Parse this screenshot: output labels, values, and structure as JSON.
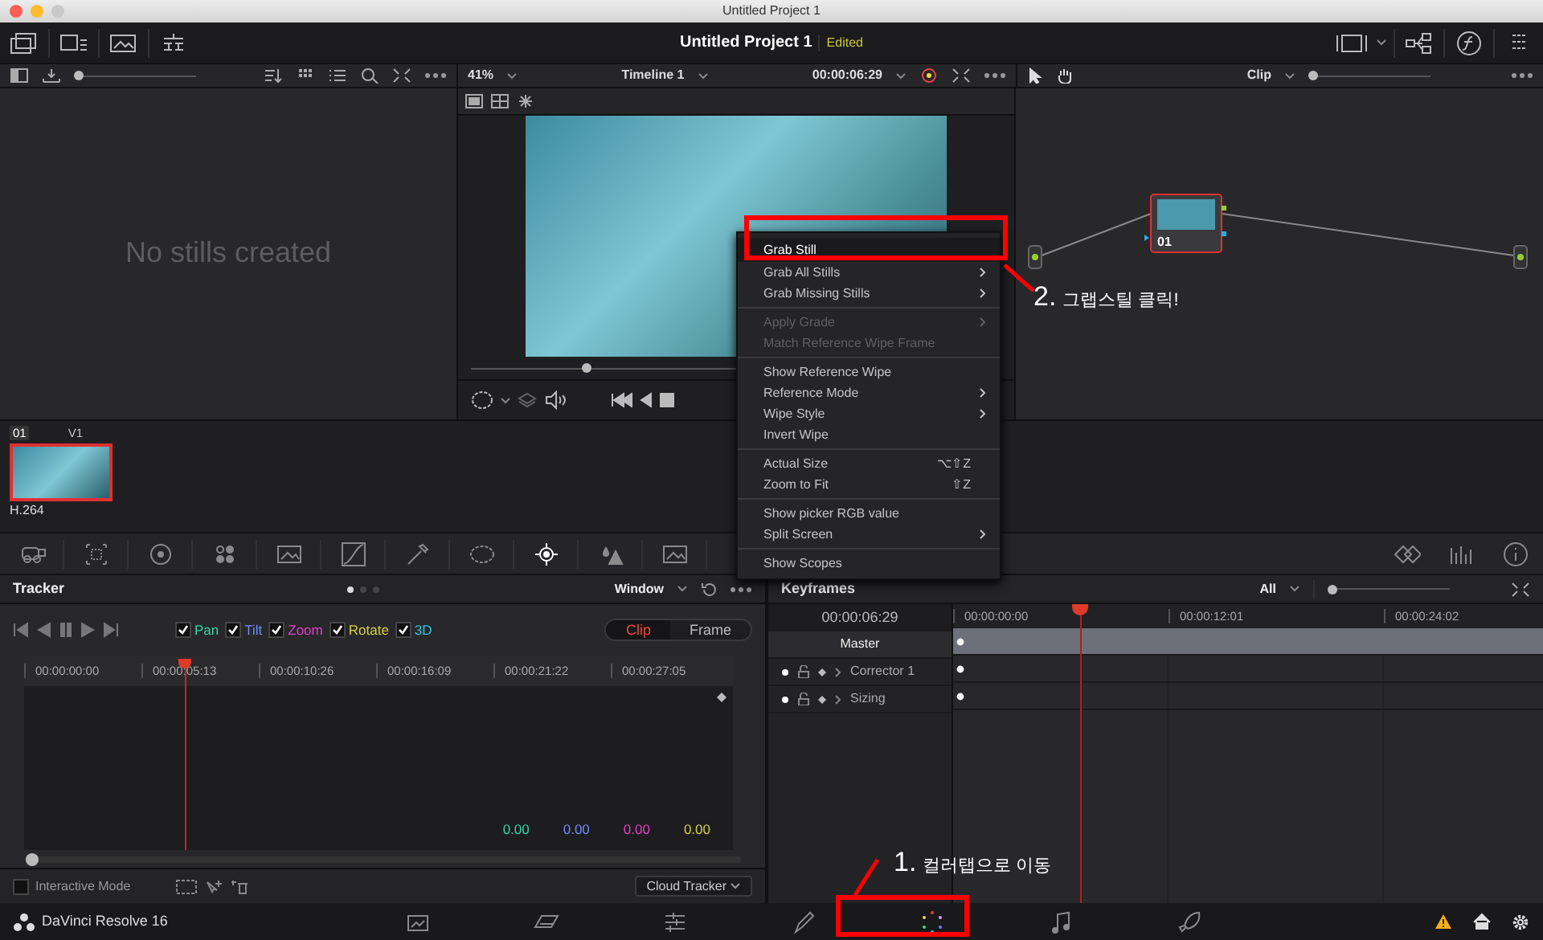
{
  "window": {
    "title": "Untitled Project 1"
  },
  "header": {
    "project": "Untitled Project 1",
    "status": "Edited"
  },
  "gallery": {
    "message": "No stills created",
    "size_slider": {
      "level": 0
    }
  },
  "viewer": {
    "zoom": "41%",
    "timeline": "Timeline 1",
    "timecode": "00:00:06:29",
    "scrubber": {
      "level": 0.22
    }
  },
  "node_editor": {
    "mode": "Clip",
    "node_label": "01",
    "zoom_slider": {
      "level": 0
    }
  },
  "clip": {
    "number": "01",
    "track": "V1",
    "codec": "H.264",
    "selected": true
  },
  "tools": [
    {
      "kind": "camera",
      "selected": false
    },
    {
      "kind": "grid",
      "selected": false
    },
    {
      "kind": "ring",
      "selected": false
    },
    {
      "kind": "dots",
      "selected": false
    },
    {
      "kind": "picture",
      "selected": false
    },
    {
      "kind": "curve",
      "selected": false
    },
    {
      "kind": "dropper",
      "selected": false
    },
    {
      "kind": "window",
      "selected": false
    },
    {
      "kind": "target",
      "selected": true
    },
    {
      "kind": "drops",
      "selected": false
    },
    {
      "kind": "picture",
      "selected": false
    }
  ],
  "side_tools": [
    {
      "kind": "diamond",
      "selected": false
    },
    {
      "kind": "bars",
      "selected": false
    },
    {
      "kind": "info",
      "selected": false
    }
  ],
  "context_menu": {
    "groups": [
      [
        {
          "label": "Grab Still",
          "selected": true,
          "disabled": false,
          "submenu": false
        },
        {
          "label": "Grab All Stills",
          "selected": false,
          "disabled": false,
          "submenu": true
        },
        {
          "label": "Grab Missing Stills",
          "selected": false,
          "disabled": false,
          "submenu": true
        }
      ],
      [
        {
          "label": "Apply Grade",
          "selected": false,
          "disabled": true,
          "submenu": true
        },
        {
          "label": "Match Reference Wipe Frame",
          "selected": false,
          "disabled": true,
          "submenu": false
        }
      ],
      [
        {
          "label": "Show Reference Wipe",
          "selected": false,
          "disabled": false,
          "submenu": false
        },
        {
          "label": "Reference Mode",
          "selected": false,
          "disabled": false,
          "submenu": true
        },
        {
          "label": "Wipe Style",
          "selected": false,
          "disabled": false,
          "submenu": true
        },
        {
          "label": "Invert Wipe",
          "selected": false,
          "disabled": false,
          "submenu": false
        }
      ],
      [
        {
          "label": "Actual Size",
          "shortcut": "⌥⇧Z",
          "selected": false,
          "disabled": false,
          "submenu": false
        },
        {
          "label": "Zoom to Fit",
          "shortcut": "⇧Z",
          "selected": false,
          "disabled": false,
          "submenu": false
        }
      ],
      [
        {
          "label": "Show picker RGB value",
          "selected": false,
          "disabled": false,
          "submenu": false
        },
        {
          "label": "Split Screen",
          "selected": false,
          "disabled": false,
          "submenu": true
        }
      ],
      [
        {
          "label": "Show Scopes",
          "selected": false,
          "disabled": false,
          "submenu": false
        }
      ]
    ]
  },
  "tracker": {
    "title": "Tracker",
    "pages": [
      {
        "selected": true
      },
      {
        "selected": false
      },
      {
        "selected": false
      }
    ],
    "window_mode": "Window",
    "channels": [
      {
        "label": "Pan",
        "checked": true,
        "color": "#33d6a4"
      },
      {
        "label": "Tilt",
        "checked": true,
        "color": "#6f8cff"
      },
      {
        "label": "Zoom",
        "checked": true,
        "color": "#e040c8"
      },
      {
        "label": "Rotate",
        "checked": true,
        "color": "#d6d042"
      },
      {
        "label": "3D",
        "checked": true,
        "color": "#2ec6e0"
      }
    ],
    "modes": [
      {
        "label": "Clip",
        "selected": true
      },
      {
        "label": "Frame",
        "selected": false
      }
    ],
    "ruler": [
      "00:00:00:00",
      "00:00:05:13",
      "00:00:10:26",
      "00:00:16:09",
      "00:00:21:22",
      "00:00:27:05"
    ],
    "values": [
      {
        "text": "0.00",
        "color": "#33d6a4"
      },
      {
        "text": "0.00",
        "color": "#6f8cff"
      },
      {
        "text": "0.00",
        "color": "#e040c8"
      },
      {
        "text": "0.00",
        "color": "#d6d042"
      }
    ],
    "interactive_mode": {
      "label": "Interactive Mode",
      "checked": false
    },
    "tracker_type": "Cloud Tracker"
  },
  "keyframes": {
    "title": "Keyframes",
    "filter": "All",
    "zoom_slider": {
      "level": 0
    },
    "timecode": "00:00:06:29",
    "ruler": [
      "00:00:00:00",
      "00:00:12:01",
      "00:00:24:02"
    ],
    "tracks": [
      {
        "label": "Master",
        "selected": true,
        "expandable": false
      },
      {
        "label": "Corrector 1",
        "selected": false,
        "expandable": true
      },
      {
        "label": "Sizing",
        "selected": false,
        "expandable": true
      }
    ]
  },
  "footer": {
    "app": "DaVinci Resolve 16",
    "pages": [
      {
        "kind": "media",
        "selected": false
      },
      {
        "kind": "cut",
        "selected": false
      },
      {
        "kind": "edit",
        "selected": false
      },
      {
        "kind": "fusion",
        "selected": false
      },
      {
        "kind": "color",
        "selected": true
      },
      {
        "kind": "fairlight",
        "selected": false
      },
      {
        "kind": "deliver",
        "selected": false
      }
    ]
  },
  "annotations": [
    {
      "number": "1.",
      "text": "컬러탭으로 이동"
    },
    {
      "number": "2.",
      "text": "그랩스틸 클릭!"
    }
  ]
}
